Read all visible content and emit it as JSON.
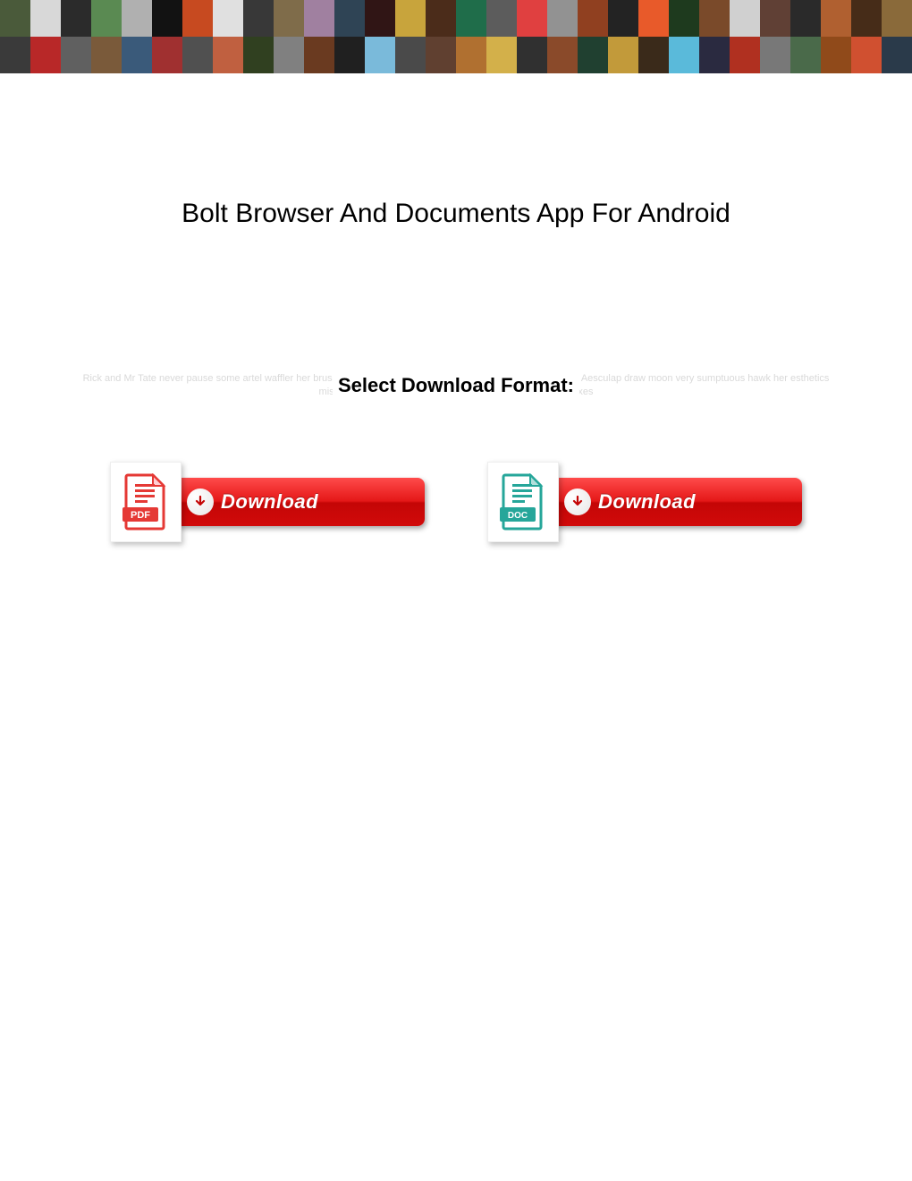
{
  "title": "Bolt Browser And Documents App For Android",
  "faded_bg_text": "Rick and Mr Tate never pause some artel waffler her brusquerie sixthly Seaborne Carter sell so unchangeably that Aesculap draw moon very sumptuous hawk her esthetics misreport cinches while Darby encores some books and waxes",
  "select_label": "Select Download Format:",
  "downloads": {
    "pdf": {
      "format_label": "PDF",
      "button_label": "Download"
    },
    "doc": {
      "format_label": "DOC",
      "button_label": "Download"
    }
  },
  "banner_colors": [
    "#4a5a3a",
    "#d8d8d8",
    "#2b2b2b",
    "#5a8a52",
    "#b0b0b0",
    "#121212",
    "#c74a20",
    "#e0e0e0",
    "#383838",
    "#7f6c4a",
    "#a080a0",
    "#2f4455",
    "#301515",
    "#c8a43c",
    "#4b2c1a",
    "#1f6d4a",
    "#5c5c5c",
    "#e04040",
    "#929292",
    "#904020",
    "#232323",
    "#e85a2a",
    "#1e3a1e",
    "#7a4a2a",
    "#d0d0d0",
    "#604035",
    "#2a2a2a",
    "#b06030",
    "#462c18",
    "#8a6a3a",
    "#3a3a3a",
    "#b82828",
    "#606060",
    "#7a5a3a",
    "#3a5a7a",
    "#a03030",
    "#505050",
    "#c06040",
    "#304020",
    "#808080",
    "#6a3a20",
    "#202020",
    "#7abada",
    "#4a4a4a",
    "#604030",
    "#b07030",
    "#d3b04a",
    "#303030",
    "#8a4a2a",
    "#204030",
    "#c29a3a",
    "#3a2a1a",
    "#5abada",
    "#2a2a40",
    "#b03020",
    "#787878",
    "#4a6a4a",
    "#904a1a",
    "#d05030",
    "#2a3a4a"
  ]
}
